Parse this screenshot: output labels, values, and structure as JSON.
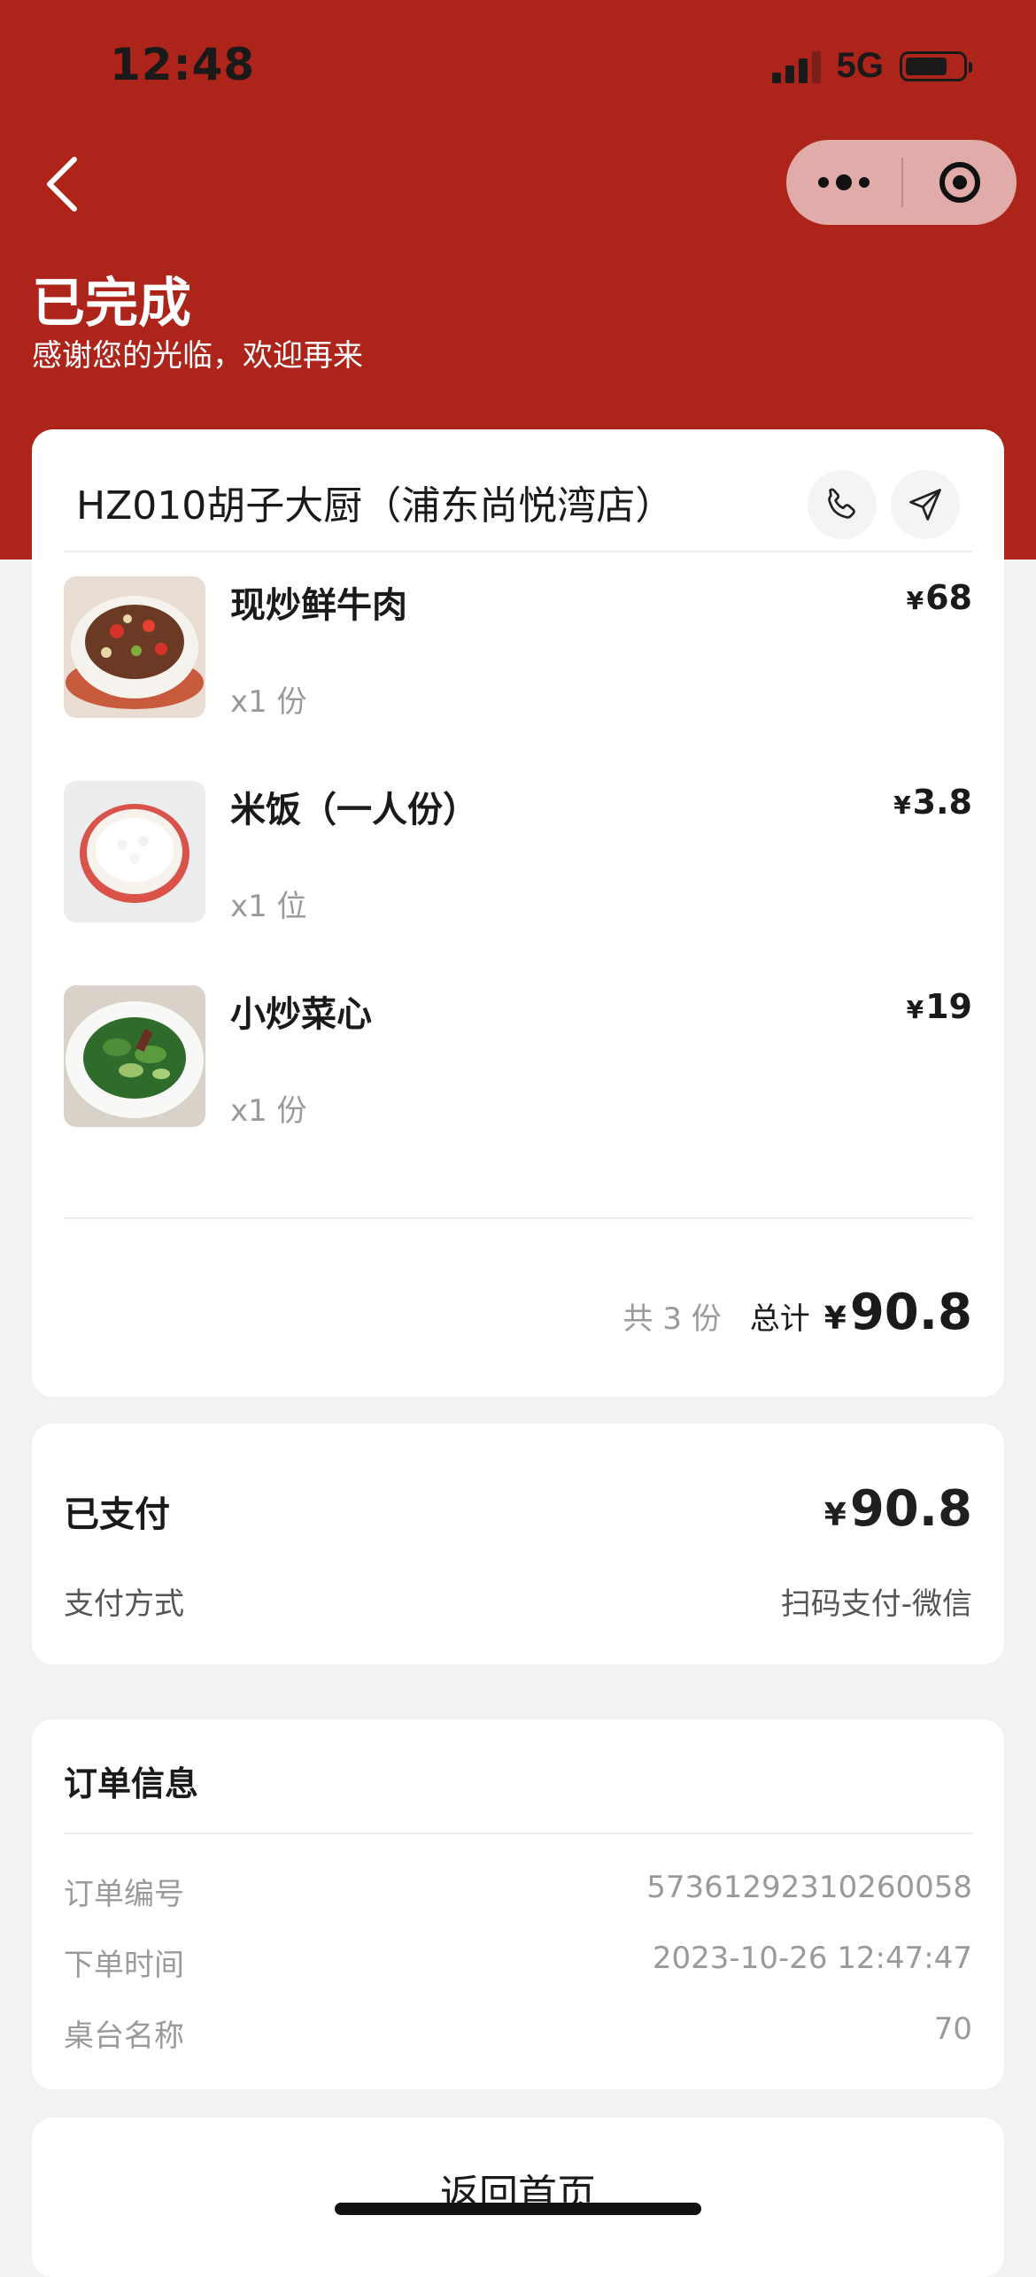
{
  "status_bar": {
    "time": "12:48",
    "network": "5G"
  },
  "header": {
    "status_title": "已完成",
    "subtitle": "感谢您的光临，欢迎再来"
  },
  "store": {
    "name": "HZ010胡子大厨（浦东尚悦湾店）",
    "phone_icon": "phone-icon",
    "navigate_icon": "navigation-arrow-icon"
  },
  "items": [
    {
      "name": "现炒鲜牛肉",
      "qty": "x1 份",
      "currency": "¥",
      "price": "68"
    },
    {
      "name": "米饭（一人份）",
      "qty": "x1 位",
      "currency": "¥",
      "price": "3.8"
    },
    {
      "name": "小炒菜心",
      "qty": "x1 份",
      "currency": "¥",
      "price": "19"
    }
  ],
  "summary": {
    "count_text": "共 3 份",
    "total_label": "总计",
    "currency": "¥",
    "total": "90.8"
  },
  "payment": {
    "paid_label": "已支付",
    "currency": "¥",
    "amount": "90.8",
    "method_label": "支付方式",
    "method_value": "扫码支付-微信"
  },
  "order_info": {
    "title": "订单信息",
    "rows": [
      {
        "label": "订单编号",
        "value": "57361292310260058"
      },
      {
        "label": "下单时间",
        "value": "2023-10-26 12:47:47"
      },
      {
        "label": "桌台名称",
        "value": "70"
      }
    ]
  },
  "footer": {
    "home_button": "返回首页"
  },
  "colors": {
    "brand_red": "#ad241b",
    "page_bg": "#f2f2f2"
  }
}
